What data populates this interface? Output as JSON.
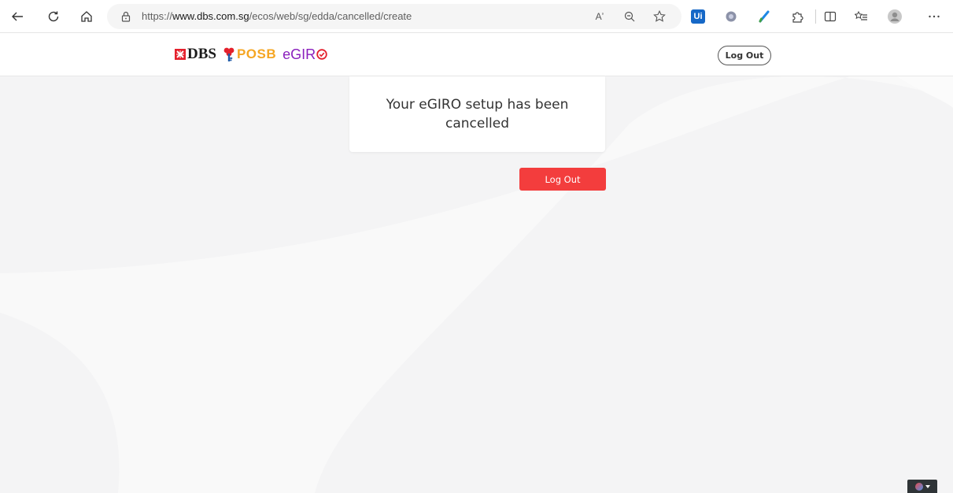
{
  "browser": {
    "url_prefix": "https://",
    "url_host": "www.dbs.com.sg",
    "url_path": "/ecos/web/sg/edda/cancelled/create",
    "read_aloud_glyph": "Aʼ",
    "extensions": {
      "ui_label": "Ui"
    }
  },
  "header": {
    "brand_dbs": "DBS",
    "brand_posb": "POSB",
    "brand_egiro": "eGIR",
    "logout_label": "Log Out"
  },
  "main": {
    "status_message": "Your eGIRO setup has been cancelled",
    "logout_button_label": "Log Out"
  },
  "colors": {
    "primary_button": "#f33d3d",
    "posb_orange": "#f5a623",
    "egiro_purple": "#8a1fbd",
    "dbs_red": "#e4202c"
  },
  "icons": [
    "back-icon",
    "reload-icon",
    "home-icon",
    "lock-icon",
    "read-aloud-icon",
    "zoom-icon",
    "favorite-star-icon",
    "ui-extension-icon",
    "me-extension-icon",
    "pen-extension-icon",
    "puzzle-extension-icon",
    "split-screen-icon",
    "collections-icon",
    "profile-icon",
    "more-icon",
    "dbs-logo-icon",
    "posb-key-icon",
    "egiro-check-icon",
    "globe-icon"
  ]
}
